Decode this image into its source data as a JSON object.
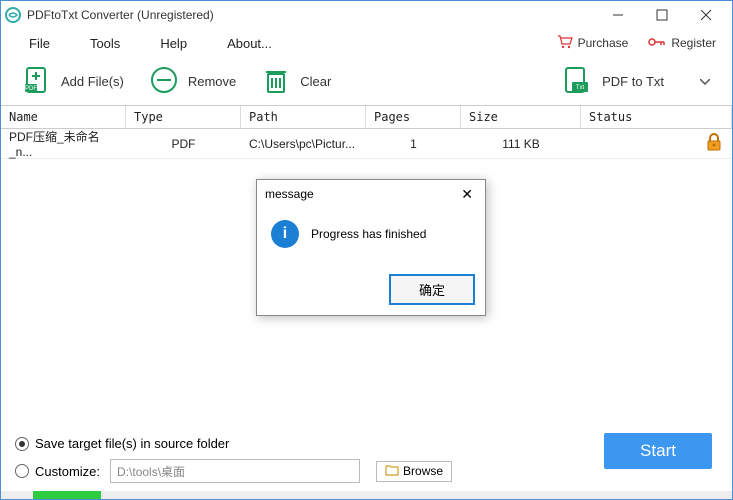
{
  "window": {
    "title": "PDFtoTxt Converter (Unregistered)"
  },
  "menubar": {
    "file": "File",
    "tools": "Tools",
    "help": "Help",
    "about": "About...",
    "purchase": "Purchase",
    "register": "Register"
  },
  "toolbar": {
    "add": "Add File(s)",
    "remove": "Remove",
    "clear": "Clear",
    "mode": "PDF to Txt"
  },
  "table": {
    "headers": {
      "name": "Name",
      "type": "Type",
      "path": "Path",
      "pages": "Pages",
      "size": "Size",
      "status": "Status"
    },
    "rows": [
      {
        "name": "PDF压缩_未命名_n...",
        "type": "PDF",
        "path": "C:\\Users\\pc\\Pictur...",
        "pages": "1",
        "size": "111 KB",
        "status": "locked"
      }
    ]
  },
  "dialog": {
    "title": "message",
    "body": "Progress has finished",
    "ok": "确定"
  },
  "footer": {
    "save_in_source": "Save target file(s) in source folder",
    "customize": "Customize:",
    "customize_path": "D:\\tools\\桌面",
    "browse": "Browse",
    "start": "Start"
  }
}
